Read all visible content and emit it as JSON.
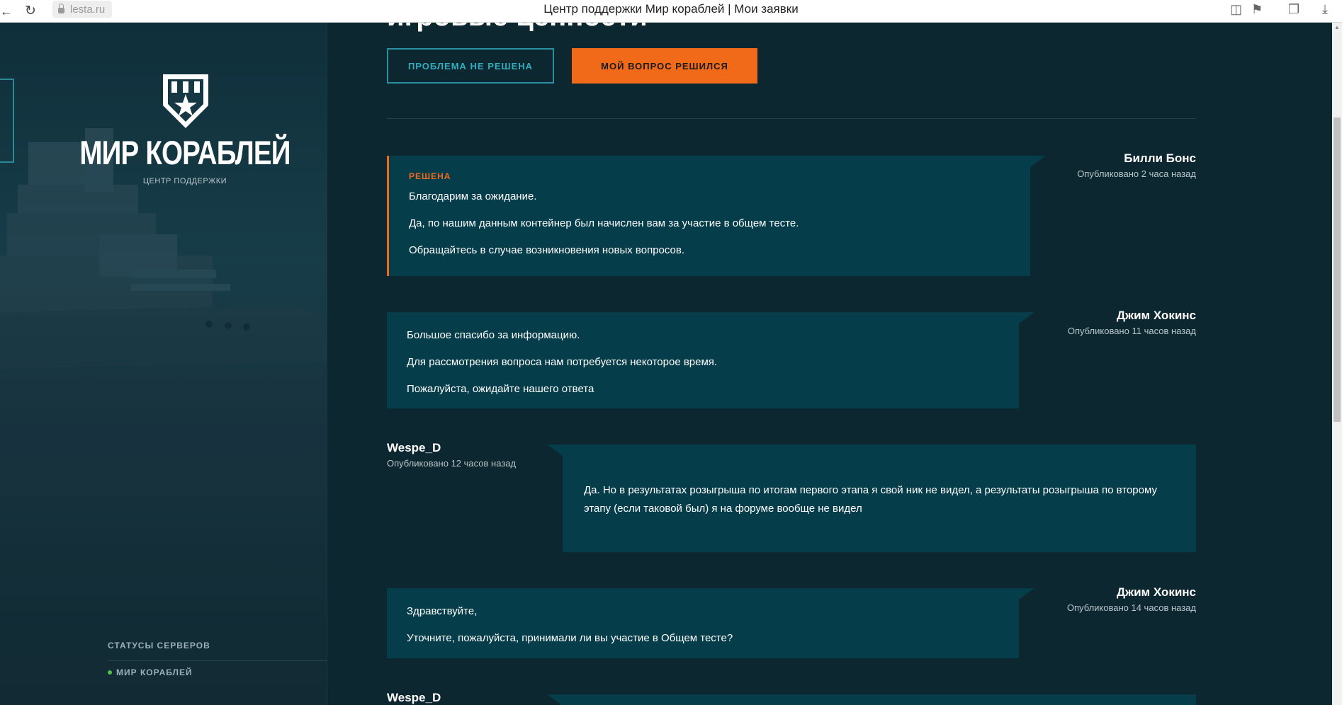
{
  "browser": {
    "back_icon": "arrow-left-icon",
    "reload_icon": "reload-icon",
    "url": "lesta.ru",
    "title": "Центр поддержки Мир кораблей | Мои заявки"
  },
  "sidebar": {
    "logo_text": "МИР КОРАБЛЕЙ",
    "logo_subtitle": "ЦЕНТР ПОДДЕРЖКИ",
    "status_title": "СТАТУСЫ СЕРВЕРОВ",
    "servers": [
      {
        "name": "МИР КОРАБЛЕЙ",
        "status_color": "#4fbf47"
      }
    ]
  },
  "main": {
    "heading": "игровые ценности",
    "buttons": {
      "not_solved": "ПРОБЛЕМА НЕ РЕШЕНА",
      "solved": "МОЙ ВОПРОС РЕШИЛСЯ"
    },
    "messages": [
      {
        "author": "Билли Бонс",
        "time": "Опубликовано 2 часа назад",
        "status": "РЕШЕНА",
        "lines": [
          "Благодарим за ожидание.",
          "Да, по нашим данным контейнер был начислен вам за участие в общем тесте.",
          "Обращайтесь в случае возникновения новых вопросов."
        ]
      },
      {
        "author": "Джим Хокинс",
        "time": "Опубликовано 11 часов назад",
        "lines": [
          "Большое спасибо за информацию.",
          "Для рассмотрения вопроса нам потребуется некоторое время.",
          "Пожалуйста, ожидайте нашего ответа"
        ]
      },
      {
        "author": "Wespe_D",
        "time": "Опубликовано 12 часов назад",
        "lines": [
          "Да. Но в результатах розыгрыша по итогам первого этапа я свой ник не видел, а результаты розыгрыша по второму этапу (если таковой был) я на форуме вообще не видел"
        ]
      },
      {
        "author": "Джим Хокинс",
        "time": "Опубликовано 14 часов назад",
        "lines": [
          "Здравствуйте,",
          "Уточните, пожалуйста, принимали ли вы участие в Общем тесте?"
        ]
      },
      {
        "author": "Wespe_D"
      }
    ]
  },
  "colors": {
    "accent_orange": "#f06a1a",
    "accent_teal": "#2a8f9e",
    "message_bg": "#063d4b",
    "page_bg": "#0d2730"
  }
}
